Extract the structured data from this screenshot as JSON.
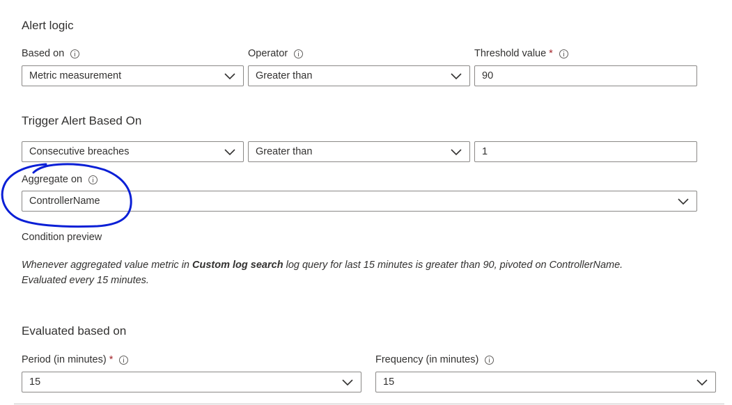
{
  "alert_logic": {
    "title": "Alert logic",
    "based_on": {
      "label": "Based on",
      "value": "Metric measurement"
    },
    "operator": {
      "label": "Operator",
      "value": "Greater than"
    },
    "threshold": {
      "label": "Threshold value",
      "required_mark": "*",
      "value": "90"
    }
  },
  "trigger": {
    "title": "Trigger Alert Based On",
    "type_value": "Consecutive breaches",
    "operator_value": "Greater than",
    "count_value": "1"
  },
  "aggregate": {
    "label": "Aggregate on",
    "value": "ControllerName"
  },
  "condition_preview": {
    "title": "Condition preview",
    "text_before": "Whenever aggregated value metric in ",
    "text_bold": "Custom log search",
    "text_after": " log query for last 15 minutes is greater than 90, pivoted on ControllerName.",
    "line2": "Evaluated every 15 minutes."
  },
  "evaluation": {
    "title": "Evaluated based on",
    "period": {
      "label": "Period (in minutes)",
      "required_mark": "*",
      "value": "15"
    },
    "frequency": {
      "label": "Frequency (in minutes)",
      "value": "15"
    }
  },
  "colors": {
    "annotation": "#0a1fd6",
    "required": "#a4262c",
    "border": "#8a8886"
  },
  "icons": [
    "info-icon",
    "chevron-down-icon"
  ]
}
